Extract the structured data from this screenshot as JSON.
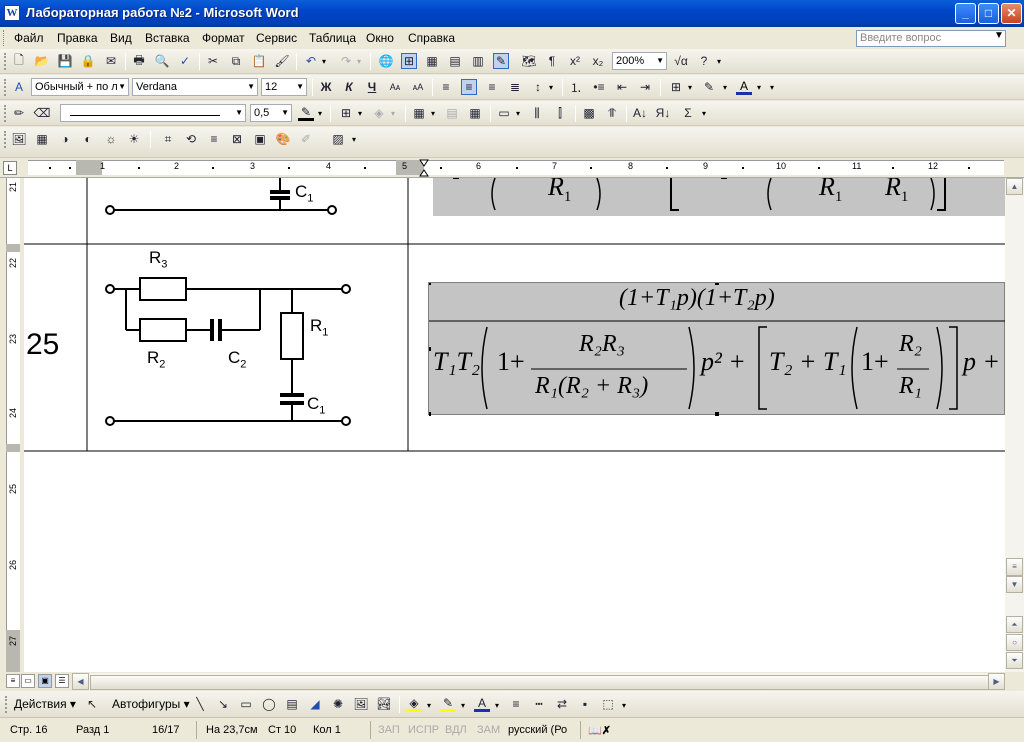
{
  "window": {
    "title": "Лабораторная работа №2 - Microsoft Word",
    "app_icon": "W",
    "minimize": "_",
    "maximize": "□",
    "close": "✕"
  },
  "menu": {
    "items": [
      "Файл",
      "Правка",
      "Вид",
      "Вставка",
      "Формат",
      "Сервис",
      "Таблица",
      "Окно",
      "Справка"
    ],
    "help_placeholder": "Введите вопрос"
  },
  "toolbar_standard": {
    "zoom": "200%"
  },
  "toolbar_format": {
    "style": "Обычный + по л",
    "font": "Verdana",
    "size": "12",
    "bold": "Ж",
    "italic": "К",
    "underline": "Ч"
  },
  "toolbar_draw_lines": {
    "line_weight": "0,5"
  },
  "ruler": {
    "h_numbers": [
      "1",
      "1",
      "2",
      "3",
      "4",
      "5",
      "6",
      "7",
      "8",
      "9",
      "10",
      "11",
      "12"
    ],
    "v_numbers": [
      "21",
      "22",
      "23",
      "24",
      "25",
      "26",
      "27"
    ],
    "corner_glyph": "L"
  },
  "document": {
    "row_number": "25",
    "top_circuit_label": "C",
    "top_circuit_sub": "1",
    "circuit_labels": {
      "r3": "R",
      "r3_sub": "3",
      "r2": "R",
      "r2_sub": "2",
      "c2": "C",
      "c2_sub": "2",
      "r1": "R",
      "r1_sub": "1",
      "c1": "C",
      "c1_sub": "1"
    },
    "formula_top_partial": {
      "r1": "R",
      "r1_sub": "1",
      "r1b": "R",
      "r1b_sub": "1",
      "r1c": "R",
      "r1c_sub": "1"
    },
    "formula": {
      "numerator": "(1+T₁p)(1+T₂p)",
      "t1t2": "T₁T₂",
      "one": "1+",
      "r2r3": "R₂R₃",
      "r1_r2_r3": "R₁(R₂ + R₃)",
      "p2": "p² +",
      "t2_t1": "T₂ + T₁",
      "one_b": "1+",
      "r2": "R₂",
      "r1": "R₁",
      "p_plus": "p +"
    }
  },
  "drawing_bar": {
    "actions": "Действия",
    "autoshapes": "Автофигуры"
  },
  "status": {
    "page": "Стр. 16",
    "section": "Разд 1",
    "pages": "16/17",
    "at": "На 23,7см",
    "line": "Ст 10",
    "col": "Кол 1",
    "rec": "ЗАП",
    "trk": "ИСПР",
    "ext": "ВДЛ",
    "ovr": "ЗАМ",
    "language": "русский (Ро"
  }
}
